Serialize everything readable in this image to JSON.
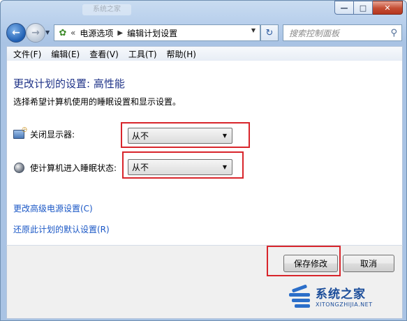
{
  "window": {
    "title_hint": "系统之家",
    "buttons": {
      "minimize_icon": "minimize-icon",
      "maximize_icon": "maximize-icon",
      "close_icon": "close-icon"
    }
  },
  "nav": {
    "back_icon": "back-arrow-icon",
    "forward_icon": "forward-arrow-icon",
    "breadcrumb": [
      "电源选项",
      "编辑计划设置"
    ],
    "breadcrumb_prefix": "«",
    "search_placeholder": "搜索控制面板"
  },
  "menu": {
    "items": [
      "文件(F)",
      "编辑(E)",
      "查看(V)",
      "工具(T)",
      "帮助(H)"
    ]
  },
  "main": {
    "heading": "更改计划的设置: 高性能",
    "subtext": "选择希望计算机使用的睡眠设置和显示设置。",
    "settings": [
      {
        "label": "关闭显示器:",
        "value": "从不",
        "icon": "monitor-power-icon"
      },
      {
        "label": "使计算机进入睡眠状态:",
        "value": "从不",
        "icon": "sleep-moon-icon"
      }
    ],
    "links": [
      "更改高级电源设置(C)",
      "还原此计划的默认设置(R)"
    ]
  },
  "footer": {
    "save_label": "保存修改",
    "cancel_label": "取消"
  },
  "watermark": {
    "cn": "系统之家",
    "en": "XITONGZHIJIA.NET"
  },
  "colors": {
    "highlight": "#d8252b",
    "heading": "#1e3287",
    "link": "#1a57c6"
  }
}
